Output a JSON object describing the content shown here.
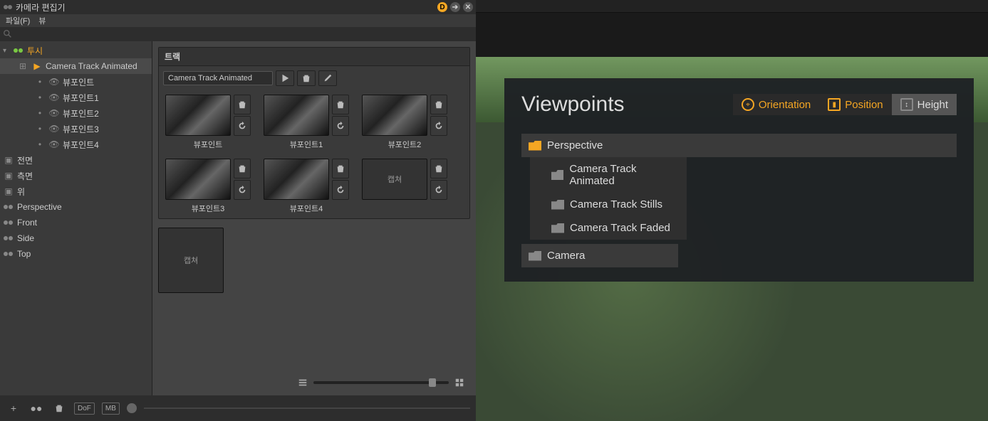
{
  "window": {
    "title": "카메라 편집기"
  },
  "menu": {
    "file": "파일(F)",
    "view": "뷰"
  },
  "tree": {
    "root": "투시",
    "track": "Camera Track Animated",
    "vp0": "뷰포인트",
    "vp1": "뷰포인트1",
    "vp2": "뷰포인트2",
    "vp3": "뷰포인트3",
    "vp4": "뷰포인트4",
    "front_k": "전면",
    "side_k": "측면",
    "top_k": "위",
    "perspective": "Perspective",
    "front": "Front",
    "side": "Side",
    "top": "Top"
  },
  "track": {
    "header": "트랙",
    "name": "Camera Track Animated"
  },
  "thumbs": {
    "t0": "뷰포인트",
    "t1": "뷰포인트1",
    "t2": "뷰포인트2",
    "t3": "뷰포인트3",
    "t4": "뷰포인트4",
    "capture": "캡쳐"
  },
  "status": {
    "dof": "DoF",
    "mb": "MB"
  },
  "right": {
    "title": "Viewpoints",
    "orientation": "Orientation",
    "position": "Position",
    "height": "Height",
    "perspective": "Perspective",
    "cta": "Camera Track Animated",
    "cts": "Camera Track Stills",
    "ctf": "Camera Track Faded",
    "camera": "Camera"
  }
}
